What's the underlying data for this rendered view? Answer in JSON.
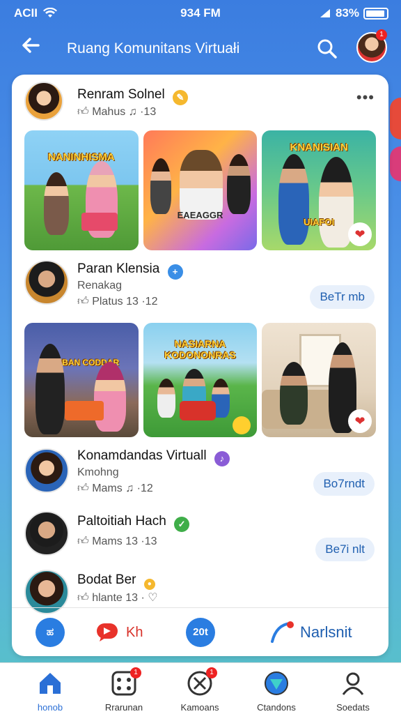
{
  "status_bar": {
    "signal": "ACII",
    "time": "934 FM",
    "battery": "83%"
  },
  "header": {
    "title": "Ruang Komunitans Virtuałi",
    "back_icon": "back-arrow-icon",
    "search_icon": "search-icon",
    "notification_count": "1"
  },
  "posts": [
    {
      "name": "Renram Solnel",
      "badge_color": "#f5b82e",
      "meta": "Mahus ♫ ·13",
      "more": "•••"
    },
    {
      "name": "Paran Klensia",
      "badge_color": "#3a8ee6",
      "sub": "Renakag",
      "meta": "Platus 13 ·12",
      "action_label": "BeTr mb"
    },
    {
      "name": "Konamdandas Virtuall",
      "badge_color": "#8a5cd6",
      "sub": "Kmohng",
      "meta": "Mams ♫ ·12",
      "action_label": "Bo7rndt"
    },
    {
      "name": "Paltoitiah Hach",
      "badge_color": "#3fae49",
      "meta": "Mams 13 ·13",
      "action_label": "Be7i nlt"
    },
    {
      "name": "Bodat Ber",
      "badge_color": "#f5b82e",
      "meta": "hlante 13 ·"
    }
  ],
  "image_rows": [
    {
      "labels": [
        "NANINHISMA",
        "EAEAGGR",
        "KNANISIAN"
      ],
      "captions": [
        "",
        "",
        "UIAFOI"
      ]
    },
    {
      "labels": [
        "KONBAN CODDAR",
        "NASIARNA KODONONRAS",
        ""
      ]
    }
  ],
  "actions": [
    {
      "icon_text": "ಹ",
      "label": ""
    },
    {
      "label": "Kh"
    },
    {
      "icon_text": "20t",
      "label": ""
    },
    {
      "label": "Narlsnit"
    }
  ],
  "nav": [
    {
      "label": "honob",
      "active": true,
      "icon": "home-icon"
    },
    {
      "label": "Rrarunan",
      "icon": "dice-icon",
      "badge": "1"
    },
    {
      "label": "Kamoans",
      "icon": "compass-icon",
      "badge": "1"
    },
    {
      "label": "Ctandons",
      "icon": "shield-icon"
    },
    {
      "label": "Soedats",
      "icon": "person-icon"
    }
  ],
  "colors": {
    "accent": "#2a7de1",
    "nav_active": "#2a6fd6"
  }
}
